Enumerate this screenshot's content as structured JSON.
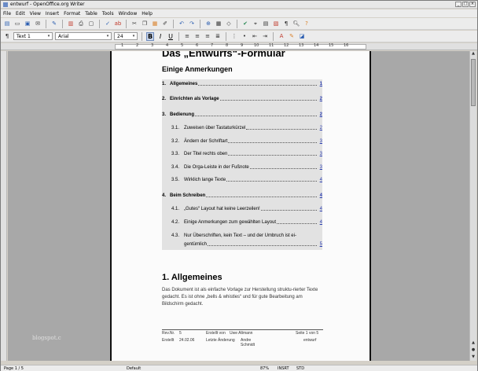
{
  "window": {
    "title": "entwurf - OpenOffice.org Writer"
  },
  "menu": [
    "File",
    "Edit",
    "View",
    "Insert",
    "Format",
    "Table",
    "Tools",
    "Window",
    "Help"
  ],
  "toolbar": {
    "style_value": "Text 1",
    "font_value": "Arial",
    "size_value": "24"
  },
  "ruler_numbers": [
    "1",
    "2",
    "3",
    "4",
    "5",
    "6",
    "7",
    "8",
    "9",
    "10",
    "11",
    "12",
    "13",
    "14",
    "15",
    "16"
  ],
  "document": {
    "title": "Das „Entwurfs“-Formular",
    "subtitle": "Einige Anmerkungen",
    "toc": [
      {
        "num": "1.",
        "text": "Allgemeines",
        "page": "1",
        "level": 1
      },
      {
        "num": "2.",
        "text": "Einrichten als Vorlage",
        "page": "2",
        "level": 1
      },
      {
        "num": "3.",
        "text": "Bedienung",
        "page": "2",
        "level": 1
      },
      {
        "num": "3.1.",
        "text": "Zuweisen über Tastaturkürzel",
        "page": "2",
        "level": 2
      },
      {
        "num": "3.2.",
        "text": "Ändern der Schriftart",
        "page": "3",
        "level": 2
      },
      {
        "num": "3.3.",
        "text": "Der Titel rechts oben",
        "page": "3",
        "level": 2
      },
      {
        "num": "3.4.",
        "text": "Die Orga-Leiste in der Fußnote",
        "page": "3",
        "level": 2
      },
      {
        "num": "3.5.",
        "text": "Wirklich lange Texte",
        "page": "4",
        "level": 2
      },
      {
        "num": "4.",
        "text": "Beim Schreiben",
        "page": "4",
        "level": 1
      },
      {
        "num": "4.1.",
        "text": "„Gutes“ Layout hat keine Leerzeilen!",
        "page": "4",
        "level": 2
      },
      {
        "num": "4.2.",
        "text": "Einige Anmerkungen zum gewählten Layout",
        "page": "4",
        "level": 2
      },
      {
        "num": "4.3.",
        "text": "Nur Überschriften, kein Text – und der Umbruch ist ei-",
        "text2": "gentümlich",
        "page": "5",
        "level": 2
      }
    ],
    "heading1": "1.   Allgemeines",
    "paragraph": "Das Dokument ist als einfache Vorlage zur Herstellung struktu-rierter Texte gedacht. Es ist ohne „bells & whistles“ und für gute Bearbeitung am Bildschirm gedacht.",
    "footer": {
      "rev_label": "Rev.Nr.",
      "rev_value": "5",
      "created_label": "Erstellt von",
      "created_value": "Uwe Altmann",
      "page_label": "Seite 1 von 5",
      "date_label": "Erstellt",
      "date_value": "24.02.06",
      "changed_label": "Letzte Änderung",
      "changed_value": "Andre Schmidt",
      "status_value": "entwurf"
    }
  },
  "statusbar": {
    "page": "Page 1 / 5",
    "style": "Default",
    "zoom": "87%",
    "insert": "INSRT",
    "std": "STD"
  },
  "watermark": "blogspot.c",
  "colors": {
    "toc_bg": "#e2e2e2",
    "link": "#2a3db0",
    "desk": "#a8a8a8"
  }
}
